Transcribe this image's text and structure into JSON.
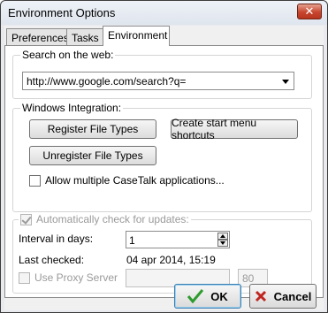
{
  "window": {
    "title": "Environment Options",
    "close_glyph": "✕"
  },
  "tabs": [
    {
      "label": "Preferences"
    },
    {
      "label": "Tasks"
    },
    {
      "label": "Environment",
      "active": true
    }
  ],
  "search": {
    "group_label": "Search on the web:",
    "selected_value": "http://www.google.com/search?q="
  },
  "windows_integration": {
    "group_label": "Windows Integration:",
    "register_label": "Register File Types",
    "shortcuts_label": "Create start menu shortcuts",
    "unregister_label": "Unregister File Types",
    "allow_multiple_label": "Allow multiple CaseTalk applications...",
    "allow_multiple_checked": false
  },
  "updates": {
    "auto_check_label": "Automatically check for updates:",
    "auto_check_checked": true,
    "auto_check_disabled": true,
    "interval_label": "Interval in days:",
    "interval_value": "1",
    "last_checked_label": "Last checked:",
    "last_checked_value": "04 apr 2014, 15:19",
    "proxy_label": "Use Proxy Server",
    "proxy_checked": false,
    "proxy_host_value": "",
    "proxy_port_value": "80"
  },
  "footer": {
    "ok_label": "OK",
    "cancel_label": "Cancel"
  },
  "colors": {
    "ok_check": "#2e9b2e",
    "cancel_x": "#c0261f"
  }
}
